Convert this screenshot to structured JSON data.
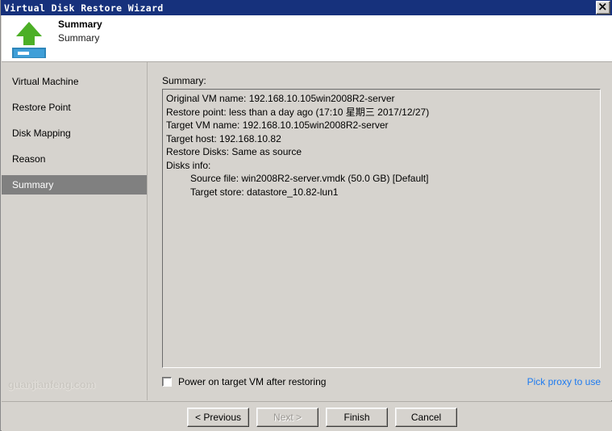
{
  "window": {
    "title": "Virtual Disk Restore Wizard",
    "close_icon": "close-icon"
  },
  "header": {
    "title": "Summary",
    "subtitle": "Summary",
    "icon": "restore-disk-arrow-icon"
  },
  "sidebar": {
    "items": [
      {
        "label": "Virtual Machine",
        "selected": false
      },
      {
        "label": "Restore Point",
        "selected": false
      },
      {
        "label": "Disk Mapping",
        "selected": false
      },
      {
        "label": "Reason",
        "selected": false
      },
      {
        "label": "Summary",
        "selected": true
      }
    ],
    "watermark": "guanjianfeng.com"
  },
  "main": {
    "summary_label": "Summary:",
    "summary_lines": [
      {
        "text": "Original VM name: 192.168.10.105win2008R2-server",
        "indent": false
      },
      {
        "text": "Restore point: less than a day ago (17:10 星期三 2017/12/27)",
        "indent": false
      },
      {
        "text": "Target VM name: 192.168.10.105win2008R2-server",
        "indent": false
      },
      {
        "text": "Target host: 192.168.10.82",
        "indent": false
      },
      {
        "text": "Restore Disks: Same as source",
        "indent": false
      },
      {
        "text": "Disks info:",
        "indent": false
      },
      {
        "text": "Source file: win2008R2-server.vmdk (50.0 GB) [Default]",
        "indent": true
      },
      {
        "text": "Target store: datastore_10.82-lun1",
        "indent": true
      }
    ],
    "power_on_label": "Power on target VM after restoring",
    "power_on_checked": false,
    "proxy_link": "Pick proxy to use"
  },
  "footer": {
    "buttons": [
      {
        "label": "< Previous",
        "disabled": false
      },
      {
        "label": "Next >",
        "disabled": true
      },
      {
        "label": "Finish",
        "disabled": false
      },
      {
        "label": "Cancel",
        "disabled": false
      }
    ]
  },
  "colors": {
    "titlebar": "#16317c",
    "dialog_face": "#d6d3ce",
    "selected_nav": "#808080",
    "link": "#1e7bf0",
    "icon_green": "#4caf26",
    "icon_blue": "#3f9fd8"
  }
}
